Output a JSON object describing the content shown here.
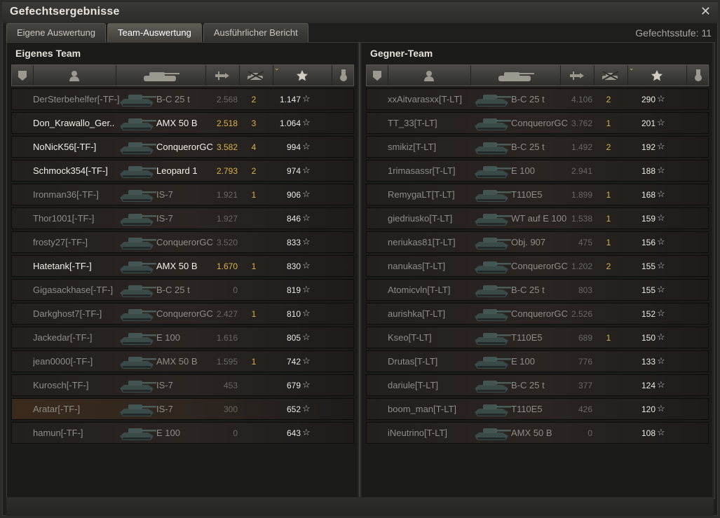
{
  "window": {
    "title": "Gefechtsergebnisse",
    "close_icon": "close-icon"
  },
  "tabs": [
    {
      "label": "Eigene Auswertung",
      "active": false
    },
    {
      "label": "Team-Auswertung",
      "active": true
    },
    {
      "label": "Ausführlicher Bericht",
      "active": false
    }
  ],
  "battle_level": "Gefechtsstufe: 11",
  "columns": {
    "icons": [
      "squad-icon",
      "player-icon",
      "tank-icon",
      "damage-icon",
      "kills-icon",
      "xp-star-icon",
      "medal-icon"
    ],
    "sorted_column": "xp-star-icon"
  },
  "teams": [
    {
      "title": "Eigenes Team",
      "players": [
        {
          "name": "DerSterbehelfer[-TF-]",
          "tank": "B-C 25 t",
          "rating": "2.568",
          "kills": "2",
          "xp": "1.147",
          "alive": false,
          "highlight": false,
          "rating_gold": false
        },
        {
          "name": "Don_Krawallo_Ger..",
          "tank": "AMX 50 B",
          "rating": "2.518",
          "kills": "3",
          "xp": "1.064",
          "alive": true,
          "highlight": false,
          "rating_gold": true
        },
        {
          "name": "NoNicK56[-TF-]",
          "tank": "ConquerorGC",
          "rating": "3.582",
          "kills": "4",
          "xp": "994",
          "alive": true,
          "highlight": false,
          "rating_gold": true
        },
        {
          "name": "Schmock354[-TF-]",
          "tank": "Leopard 1",
          "rating": "2.793",
          "kills": "2",
          "xp": "974",
          "alive": true,
          "highlight": false,
          "rating_gold": true
        },
        {
          "name": "Ironman36[-TF-]",
          "tank": "IS-7",
          "rating": "1.921",
          "kills": "1",
          "xp": "906",
          "alive": false,
          "highlight": false,
          "rating_gold": false
        },
        {
          "name": "Thor1001[-TF-]",
          "tank": "IS-7",
          "rating": "1.927",
          "kills": "",
          "xp": "846",
          "alive": false,
          "highlight": false,
          "rating_gold": false
        },
        {
          "name": "frosty27[-TF-]",
          "tank": "ConquerorGC",
          "rating": "3.520",
          "kills": "",
          "xp": "833",
          "alive": false,
          "highlight": false,
          "rating_gold": false
        },
        {
          "name": "Hatetank[-TF-]",
          "tank": "AMX 50 B",
          "rating": "1.670",
          "kills": "1",
          "xp": "830",
          "alive": true,
          "highlight": false,
          "rating_gold": true
        },
        {
          "name": "Gigasackhase[-TF-]",
          "tank": "B-C 25 t",
          "rating": "0",
          "kills": "",
          "xp": "819",
          "alive": false,
          "highlight": false,
          "rating_gold": false
        },
        {
          "name": "Darkghost7[-TF-]",
          "tank": "ConquerorGC",
          "rating": "2.427",
          "kills": "1",
          "xp": "810",
          "alive": false,
          "highlight": false,
          "rating_gold": false
        },
        {
          "name": "Jackedar[-TF-]",
          "tank": "E 100",
          "rating": "1.616",
          "kills": "",
          "xp": "805",
          "alive": false,
          "highlight": false,
          "rating_gold": false
        },
        {
          "name": "jean0000[-TF-]",
          "tank": "AMX 50 B",
          "rating": "1.595",
          "kills": "1",
          "xp": "742",
          "alive": false,
          "highlight": false,
          "rating_gold": false
        },
        {
          "name": "Kurosch[-TF-]",
          "tank": "IS-7",
          "rating": "453",
          "kills": "",
          "xp": "679",
          "alive": false,
          "highlight": false,
          "rating_gold": false
        },
        {
          "name": "Aratar[-TF-]",
          "tank": "IS-7",
          "rating": "300",
          "kills": "",
          "xp": "652",
          "alive": false,
          "highlight": true,
          "rating_gold": false
        },
        {
          "name": "hamun[-TF-]",
          "tank": "E 100",
          "rating": "0",
          "kills": "",
          "xp": "643",
          "alive": false,
          "highlight": false,
          "rating_gold": false
        }
      ]
    },
    {
      "title": "Gegner-Team",
      "players": [
        {
          "name": "xxAitvarasxx[T-LT]",
          "tank": "B-C 25 t",
          "rating": "4.106",
          "kills": "2",
          "xp": "290",
          "alive": false,
          "highlight": false,
          "rating_gold": false
        },
        {
          "name": "TT_33[T-LT]",
          "tank": "ConquerorGC",
          "rating": "3.762",
          "kills": "1",
          "xp": "201",
          "alive": false,
          "highlight": false,
          "rating_gold": false
        },
        {
          "name": "smikiz[T-LT]",
          "tank": "B-C 25 t",
          "rating": "1.492",
          "kills": "2",
          "xp": "192",
          "alive": false,
          "highlight": false,
          "rating_gold": false
        },
        {
          "name": "1rimasassr[T-LT]",
          "tank": "E 100",
          "rating": "2.941",
          "kills": "",
          "xp": "188",
          "alive": false,
          "highlight": false,
          "rating_gold": false
        },
        {
          "name": "RemygaLT[T-LT]",
          "tank": "T110E5",
          "rating": "1.899",
          "kills": "1",
          "xp": "168",
          "alive": false,
          "highlight": false,
          "rating_gold": false
        },
        {
          "name": "giedriusko[T-LT]",
          "tank": "WT auf E 100",
          "rating": "1.538",
          "kills": "1",
          "xp": "159",
          "alive": false,
          "highlight": false,
          "rating_gold": false
        },
        {
          "name": "neriukas81[T-LT]",
          "tank": "Obj. 907",
          "rating": "475",
          "kills": "1",
          "xp": "156",
          "alive": false,
          "highlight": false,
          "rating_gold": false
        },
        {
          "name": "nanukas[T-LT]",
          "tank": "ConquerorGC",
          "rating": "1.202",
          "kills": "2",
          "xp": "155",
          "alive": false,
          "highlight": false,
          "rating_gold": false
        },
        {
          "name": "Atomicvln[T-LT]",
          "tank": "B-C 25 t",
          "rating": "803",
          "kills": "",
          "xp": "155",
          "alive": false,
          "highlight": false,
          "rating_gold": false
        },
        {
          "name": "aurishka[T-LT]",
          "tank": "ConquerorGC",
          "rating": "2.526",
          "kills": "",
          "xp": "152",
          "alive": false,
          "highlight": false,
          "rating_gold": false
        },
        {
          "name": "Kseo[T-LT]",
          "tank": "T110E5",
          "rating": "689",
          "kills": "1",
          "xp": "150",
          "alive": false,
          "highlight": false,
          "rating_gold": false
        },
        {
          "name": "Drutas[T-LT]",
          "tank": "E 100",
          "rating": "776",
          "kills": "",
          "xp": "133",
          "alive": false,
          "highlight": false,
          "rating_gold": false
        },
        {
          "name": "dariule[T-LT]",
          "tank": "B-C 25 t",
          "rating": "377",
          "kills": "",
          "xp": "124",
          "alive": false,
          "highlight": false,
          "rating_gold": false
        },
        {
          "name": "boom_man[T-LT]",
          "tank": "T110E5",
          "rating": "426",
          "kills": "",
          "xp": "120",
          "alive": false,
          "highlight": false,
          "rating_gold": false
        },
        {
          "name": "iNeutrino[T-LT]",
          "tank": "AMX 50 B",
          "rating": "0",
          "kills": "",
          "xp": "108",
          "alive": false,
          "highlight": false,
          "rating_gold": false
        }
      ]
    }
  ]
}
